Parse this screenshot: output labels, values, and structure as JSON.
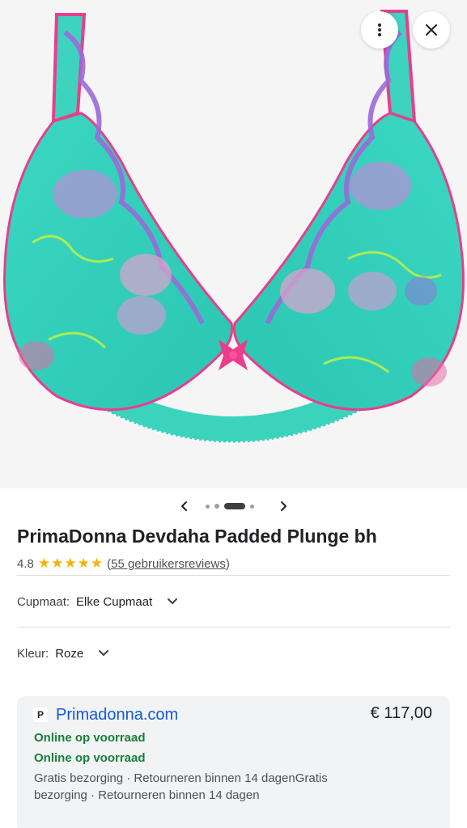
{
  "header": {
    "more_icon": "more-vert-icon",
    "close_icon": "close-icon"
  },
  "carousel": {
    "prev_icon": "chevron-left-icon",
    "next_icon": "chevron-right-icon",
    "dot_count": 4,
    "active_index": 2
  },
  "product": {
    "title": "PrimaDonna Devdaha Padded Plunge bh",
    "rating": "4.8",
    "star_count": 5,
    "reviews_open": "(",
    "reviews_link": "55 gebruikersreviews",
    "reviews_close": ")"
  },
  "options": {
    "cup": {
      "label": "Cupmaat:",
      "value": "Elke Cupmaat"
    },
    "color": {
      "label": "Kleur:",
      "value": "Roze"
    }
  },
  "seller": {
    "favicon_letter": "P",
    "name": "Primadonna.com",
    "price": "€ 117,00",
    "stock_1": "Online op voorraad",
    "stock_2": "Online op voorraad",
    "shipping": "Gratis bezorging · Retourneren binnen 14 dagenGratis bezorging · Retourneren binnen 14 dagen"
  },
  "colors": {
    "accent_link": "#1558d6",
    "in_stock": "#188038",
    "star": "#f4b400",
    "product_teal": "#3fd6c0",
    "product_pink": "#ec3d8a"
  }
}
